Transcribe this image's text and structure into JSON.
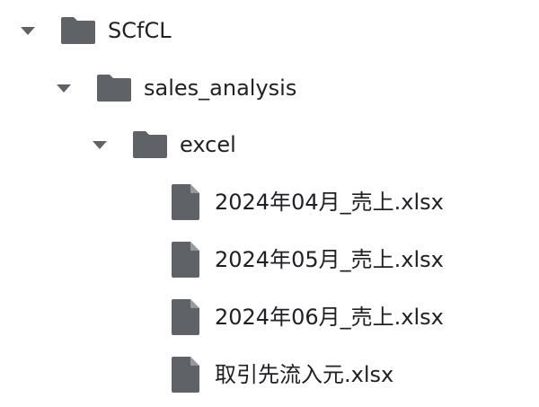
{
  "colors": {
    "icon": "#5f6368",
    "text": "#202124",
    "background": "#ffffff"
  },
  "tree": {
    "root": {
      "type": "folder",
      "expanded": true,
      "icon": "folder-icon",
      "label": "SCfCL"
    },
    "sales_analysis": {
      "type": "folder",
      "expanded": true,
      "icon": "folder-icon",
      "label": "sales_analysis"
    },
    "excel": {
      "type": "folder",
      "expanded": true,
      "icon": "folder-icon",
      "label": "excel"
    },
    "files": [
      {
        "type": "file",
        "icon": "file-icon",
        "label": "2024年04月_売上.xlsx"
      },
      {
        "type": "file",
        "icon": "file-icon",
        "label": "2024年05月_売上.xlsx"
      },
      {
        "type": "file",
        "icon": "file-icon",
        "label": "2024年06月_売上.xlsx"
      },
      {
        "type": "file",
        "icon": "file-icon",
        "label": "取引先流入元.xlsx"
      }
    ]
  }
}
